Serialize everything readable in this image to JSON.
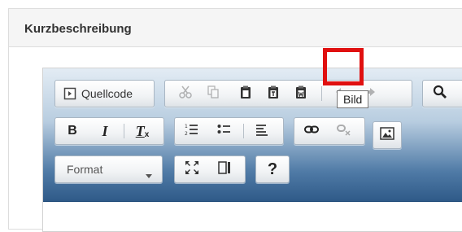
{
  "panel": {
    "title": "Kurzbeschreibung"
  },
  "toolbar": {
    "source_label": "Quellcode",
    "format_label": "Format",
    "help_label": "?",
    "bold_label": "B",
    "italic_label": "I",
    "remove_format_label": "T",
    "remove_format_sub": "x"
  },
  "tooltip": {
    "text": "Bild"
  },
  "colors": {
    "highlight": "#e01010",
    "toolbar_top": "#e3ecf4",
    "toolbar_bottom": "#2f5a88"
  },
  "icons": [
    "source-icon",
    "cut-icon",
    "copy-icon",
    "paste-icon",
    "paste-text-icon",
    "paste-word-icon",
    "undo-icon",
    "redo-icon",
    "search-icon",
    "numbered-list-icon",
    "bulleted-list-icon",
    "align-left-icon",
    "link-icon",
    "unlink-icon",
    "image-icon",
    "maximize-icon",
    "show-blocks-icon"
  ]
}
